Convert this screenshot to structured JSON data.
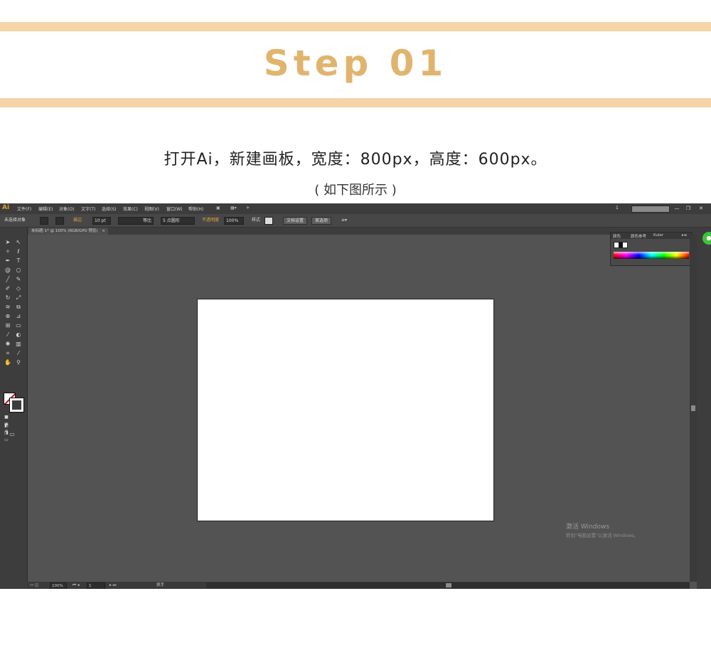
{
  "header": {
    "title": "Step 01",
    "instruction": "打开Ai，新建画板，宽度：800px，高度：600px。",
    "subtitle": "( 如下图所示 )",
    "accent_color": "#e1b46e",
    "band_color": "#f5d4a7"
  },
  "app": {
    "logo": "Ai",
    "menus": [
      "文件(F)",
      "编辑(E)",
      "对象(O)",
      "文字(T)",
      "选择(S)",
      "效果(C)",
      "视图(V)",
      "窗口(W)",
      "帮助(H)"
    ],
    "workspace_number": "1",
    "window_buttons": [
      "—",
      "❐",
      "✕"
    ]
  },
  "control_bar": {
    "selection_label": "未选择对象",
    "stroke_label": "描边",
    "stroke_weight": "10 pt",
    "profile_label": "等比",
    "brush_label": "5 点圆形",
    "opacity_label": "不透明度",
    "opacity_value": "100%",
    "style_label": "样式",
    "doc_setup_button": "文档设置",
    "preferences_button": "首选项"
  },
  "document": {
    "tab_title": "未标题-1* @ 100% (RGB/GPU 预览)",
    "tab_close": "×"
  },
  "color_panel": {
    "tabs": [
      "颜色",
      "颜色参考",
      "Kuler"
    ]
  },
  "status_bar": {
    "zoom": "100%",
    "artboard_number": "1",
    "tool_name": "抓手"
  },
  "watermark": {
    "title": "激活 Windows",
    "subtitle": "转到\"电脑设置\"以激活 Windows。"
  },
  "icons": {
    "tools": [
      "selection-icon",
      "direct-selection-icon",
      "magic-wand-icon",
      "lasso-icon",
      "pen-icon",
      "type-icon",
      "spiral-icon",
      "ellipse-icon",
      "line-icon",
      "pencil-icon",
      "brush-icon",
      "eraser-icon",
      "rotate-icon",
      "scale-icon",
      "warp-icon",
      "free-transform-icon",
      "shape-builder-icon",
      "perspective-icon",
      "mesh-icon",
      "gradient-icon",
      "eyedropper-icon",
      "blend-icon",
      "symbol-sprayer-icon",
      "graph-icon",
      "artboard-icon",
      "slice-icon",
      "hand-icon",
      "zoom-icon"
    ]
  }
}
